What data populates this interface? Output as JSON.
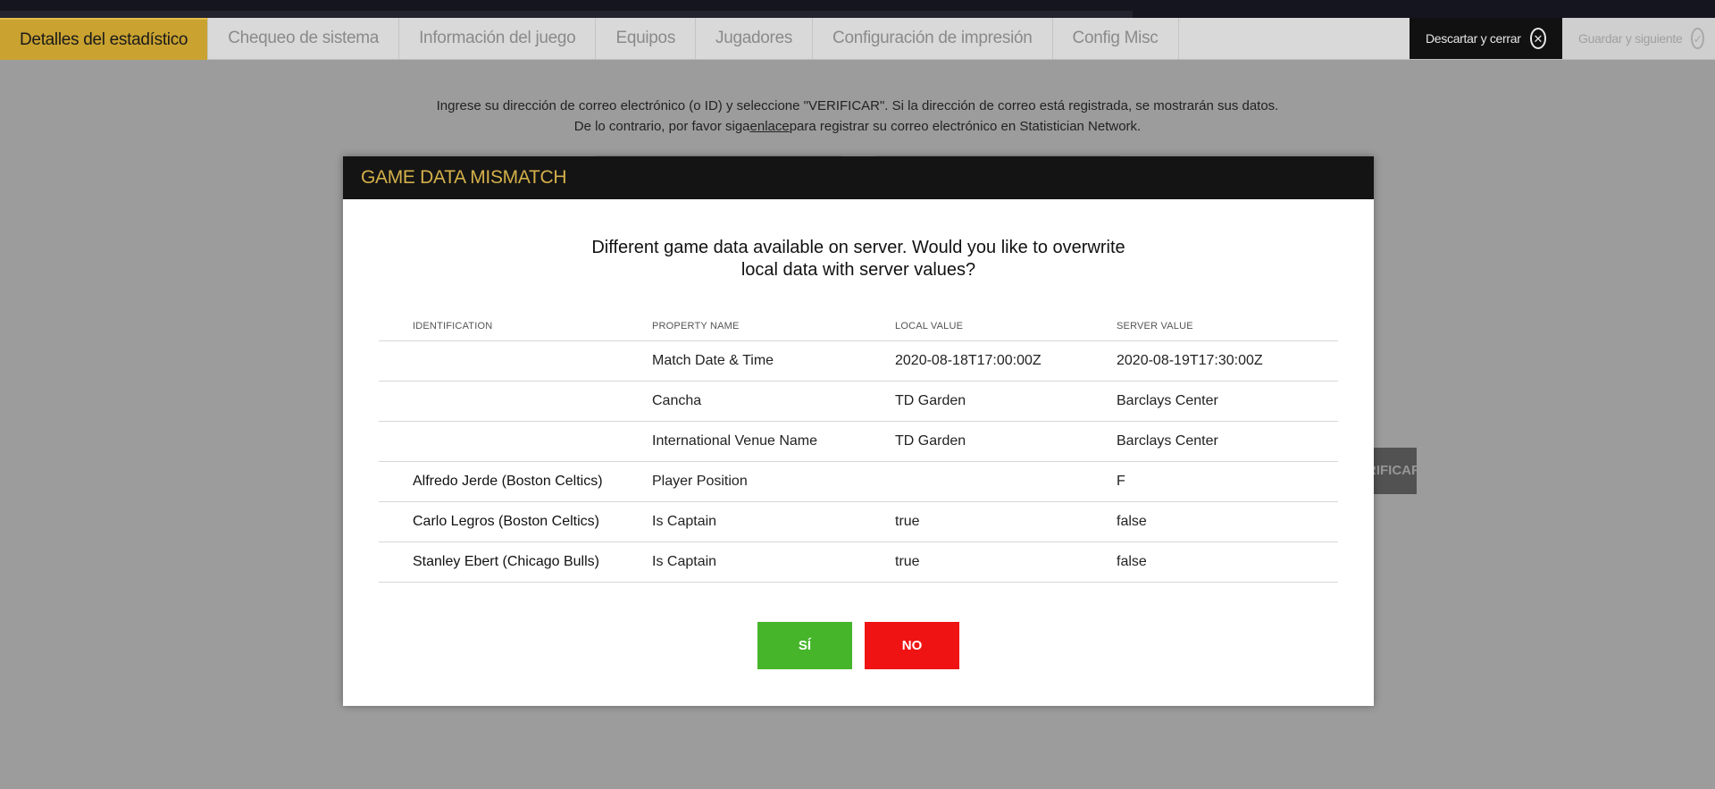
{
  "tabs": [
    {
      "label": "Detalles del estadístico",
      "active": true
    },
    {
      "label": "Chequeo de sistema",
      "active": false
    },
    {
      "label": "Información del juego",
      "active": false
    },
    {
      "label": "Equipos",
      "active": false
    },
    {
      "label": "Jugadores",
      "active": false
    },
    {
      "label": "Configuración de impresión",
      "active": false
    },
    {
      "label": "Config Misc",
      "active": false
    }
  ],
  "actions": {
    "discard_label": "Descartar y cerrar",
    "save_label": "Guardar y siguiente"
  },
  "intro": {
    "line1": "Ingrese su dirección de correo electrónico (o ID) y seleccione \"VERIFICAR\". Si la dirección de correo está registrada, se mostrarán sus datos.",
    "line2_before": "De lo contrario, por favor siga",
    "line2_link": "enlace",
    "line2_after": "para registrar su correo electrónico en Statistician Network."
  },
  "background": {
    "verify_label": "VERIFICAR"
  },
  "modal": {
    "title": "GAME DATA MISMATCH",
    "question": "Different game data available on server. Would you like to overwrite local data with server values?",
    "columns": {
      "identification": "IDENTIFICATION",
      "property": "PROPERTY NAME",
      "local": "LOCAL VALUE",
      "server": "SERVER VALUE"
    },
    "rows": [
      {
        "identification": "",
        "property": "Match Date & Time",
        "local": "2020-08-18T17:00:00Z",
        "server": "2020-08-19T17:30:00Z"
      },
      {
        "identification": "",
        "property": "Cancha",
        "local": "TD Garden",
        "server": "Barclays Center"
      },
      {
        "identification": "",
        "property": "International Venue Name",
        "local": "TD Garden",
        "server": "Barclays Center"
      },
      {
        "identification": "Alfredo Jerde (Boston Celtics)",
        "property": "Player Position",
        "local": "",
        "server": "F"
      },
      {
        "identification": "Carlo Legros (Boston Celtics)",
        "property": "Is Captain",
        "local": "true",
        "server": "false"
      },
      {
        "identification": "Stanley Ebert (Chicago Bulls)",
        "property": "Is Captain",
        "local": "true",
        "server": "false"
      }
    ],
    "yes_label": "SÍ",
    "no_label": "NO"
  },
  "colors": {
    "active_tab": "#c9a230",
    "modal_header": "#141414",
    "modal_title": "#d4b04a",
    "yes_button": "#46b52a",
    "no_button": "#f01313"
  }
}
